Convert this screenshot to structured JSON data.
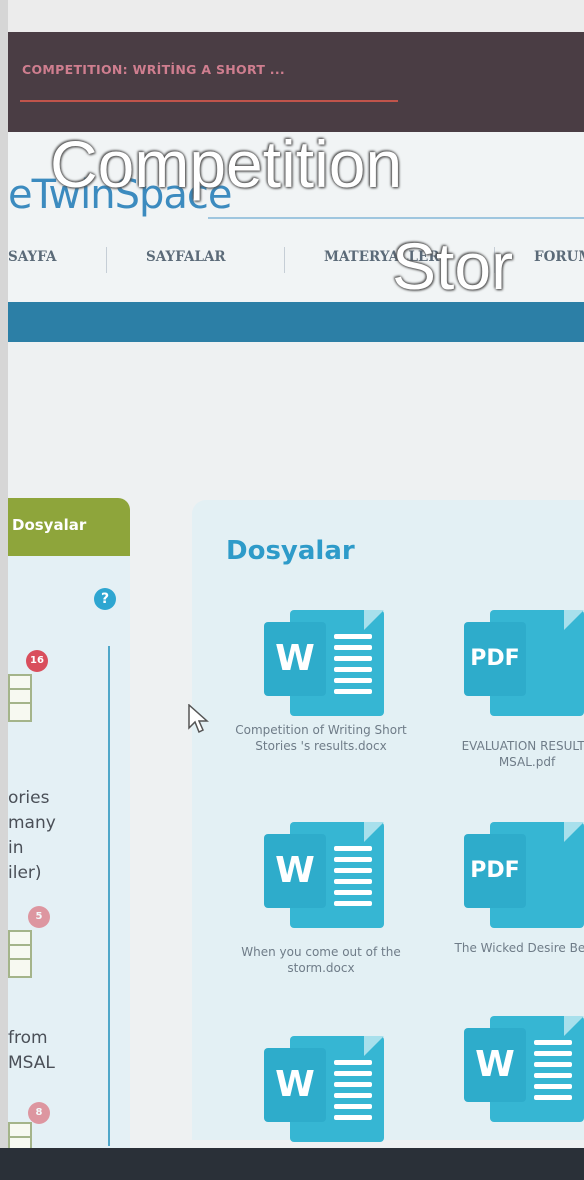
{
  "browser_tab": {
    "title": "COMPETITION: WRİTİNG A SHORT ..."
  },
  "site": {
    "logo": "eTwinSpace",
    "nav": [
      "SAYFA",
      "SAYFALAR",
      "MATERYALLER",
      "FORUM"
    ]
  },
  "sidebar": {
    "tab_label": "Dosyalar",
    "help": "?",
    "items": [
      {
        "badge": "16",
        "text": "ories\nmany\nin\niler)"
      },
      {
        "badge": "5",
        "text": "from\nMSAL"
      },
      {
        "badge": "8"
      }
    ]
  },
  "main": {
    "title": "Dosyalar",
    "files": [
      {
        "name": "Competition of Writing Short Stories 's results.docx",
        "type": "word",
        "icon": "word-doc-icon",
        "badge": "W"
      },
      {
        "name": "EVALUATION RESULTS MSAL.pdf",
        "type": "pdf",
        "icon": "pdf-doc-icon",
        "badge": "PDF"
      },
      {
        "name": "When you come out of the storm.docx",
        "type": "word",
        "icon": "word-doc-icon",
        "badge": "W"
      },
      {
        "name": "The Wicked Desire Beul.pdf",
        "type": "pdf",
        "icon": "pdf-doc-icon",
        "badge": "PDF"
      },
      {
        "type": "word",
        "icon": "word-doc-icon",
        "badge": "W"
      },
      {
        "type": "word",
        "icon": "word-doc-icon",
        "badge": "W"
      }
    ]
  },
  "overlay": {
    "line1": "Competition",
    "line2": "Stor"
  },
  "colors": {
    "accent_blue": "#2e9bc9",
    "word_blue": "#36b6d3",
    "sidebar_green": "#8ea53b",
    "badge_red": "#d94e5c"
  }
}
